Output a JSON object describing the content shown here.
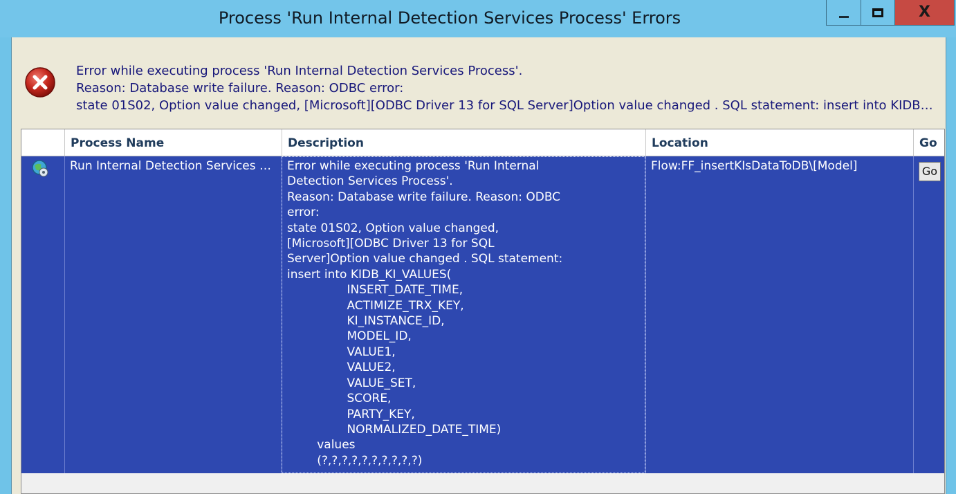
{
  "window": {
    "title": "Process 'Run Internal Detection Services Process' Errors",
    "minimize_glyph": "",
    "close_glyph": "X"
  },
  "message": {
    "icon": "error-icon",
    "line1": "Error while executing process 'Run Internal Detection Services Process'.",
    "line2": "Reason: Database write failure. Reason: ODBC error:",
    "line3": "state 01S02, Option value changed, [Microsoft][ODBC Driver 13 for SQL Server]Option value changed . SQL statement: insert into KIDB_KI_VALUES("
  },
  "table": {
    "columns": [
      "Process Name",
      "Description",
      "Location",
      "Go"
    ],
    "rows": [
      {
        "icon": "process-icon",
        "process_name": "Run Internal Detection Services Process",
        "description": "Error while executing process 'Run Internal\nDetection Services Process'.\nReason: Database write failure. Reason: ODBC\nerror:\nstate 01S02, Option value changed,\n[Microsoft][ODBC Driver 13 for SQL\nServer]Option value changed . SQL statement:\ninsert into KIDB_KI_VALUES(\n                INSERT_DATE_TIME,\n                ACTIMIZE_TRX_KEY,\n                KI_INSTANCE_ID,\n                MODEL_ID,\n                VALUE1,\n                VALUE2,\n                VALUE_SET,\n                SCORE,\n                PARTY_KEY,\n                NORMALIZED_DATE_TIME)\n        values\n        (?,?,?,?,?,?,?,?,?,?)",
        "location": "Flow:FF_insertKIsDataToDB\\[Model]",
        "go_label": "Go"
      }
    ]
  },
  "colors": {
    "titlebar": "#73c5ea",
    "close_button": "#c64a43",
    "selected_row": "#2e48b0",
    "message_text": "#17177a"
  }
}
